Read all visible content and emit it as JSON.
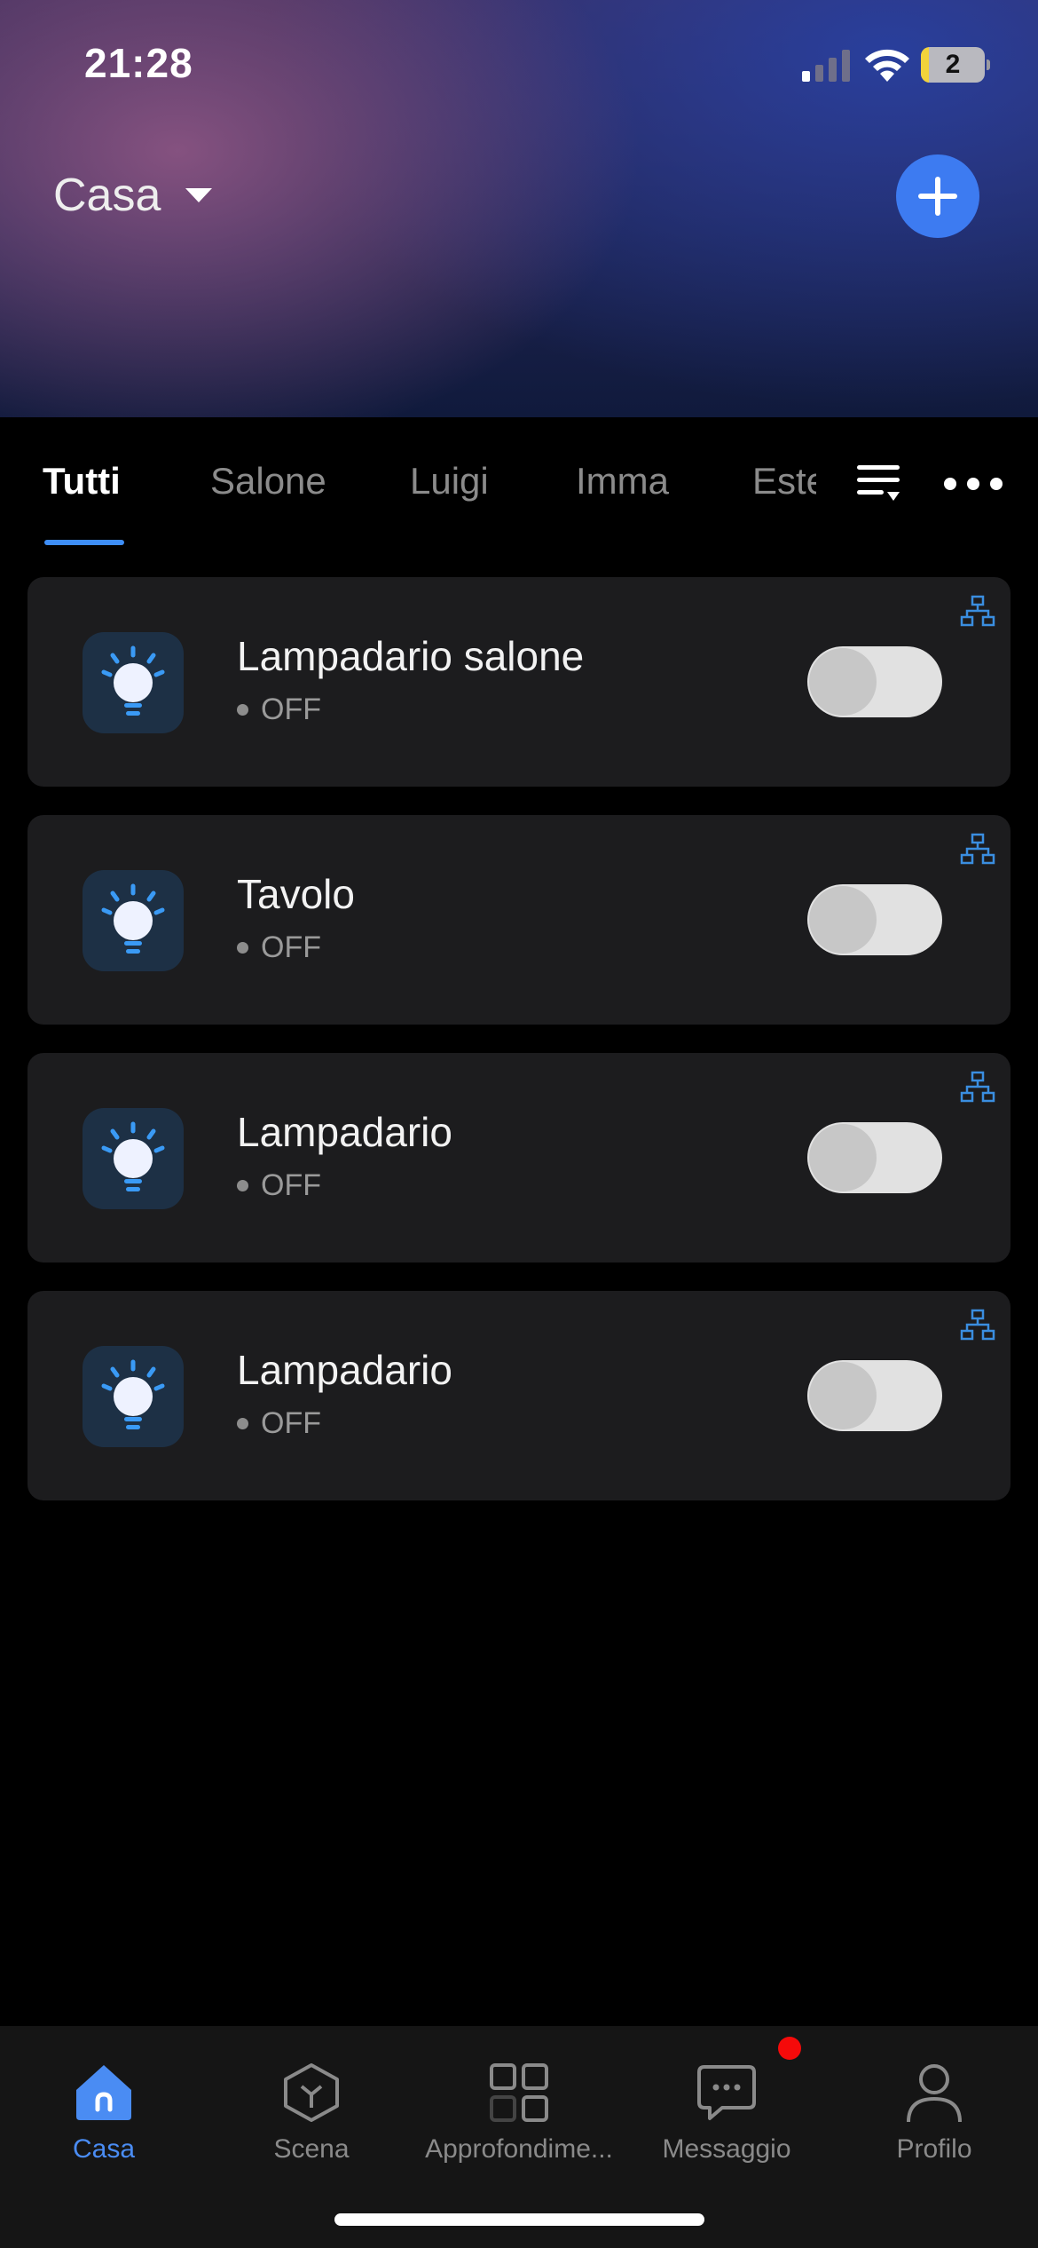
{
  "status_bar": {
    "time": "21:28",
    "battery_level": "2",
    "icons": [
      "cellular-signal-icon",
      "wifi-icon",
      "battery-icon"
    ]
  },
  "header": {
    "home_name": "Casa",
    "add_icon": "plus-icon",
    "accent_color": "#3d7bf1"
  },
  "tabs": {
    "items": [
      {
        "label": "Tutti",
        "active": true
      },
      {
        "label": "Salone",
        "active": false
      },
      {
        "label": "Luigi",
        "active": false
      },
      {
        "label": "Imma",
        "active": false
      },
      {
        "label": "Esterno",
        "active": false
      }
    ],
    "sort_icon": "sort-list-icon",
    "more_icon": "more-horizontal-icon",
    "indicator_color": "#3e8ef7"
  },
  "devices": [
    {
      "name": "Lampadario salone",
      "status": "OFF",
      "on": false,
      "icon": "light-bulb-icon"
    },
    {
      "name": "Tavolo",
      "status": "OFF",
      "on": false,
      "icon": "light-bulb-icon"
    },
    {
      "name": "Lampadario",
      "status": "OFF",
      "on": false,
      "icon": "light-bulb-icon"
    },
    {
      "name": "Lampadario",
      "status": "OFF",
      "on": false,
      "icon": "light-bulb-icon"
    }
  ],
  "bottom_nav": {
    "items": [
      {
        "label": "Casa",
        "icon": "home-icon",
        "active": true
      },
      {
        "label": "Scena",
        "icon": "scene-cube-icon",
        "active": false
      },
      {
        "label": "Approfondime...",
        "icon": "grid-icon",
        "active": false
      },
      {
        "label": "Messaggio",
        "icon": "message-icon",
        "active": false,
        "has_notification": true
      },
      {
        "label": "Profilo",
        "icon": "profile-icon",
        "active": false
      }
    ],
    "active_color": "#4a8cf3",
    "notification_color": "#f50a0a"
  }
}
